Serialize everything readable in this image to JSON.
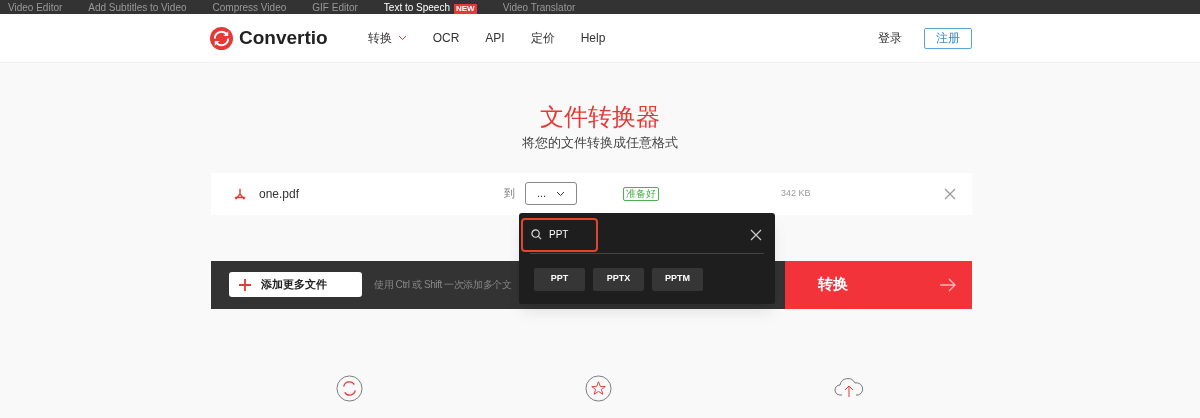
{
  "top_bar": {
    "links": [
      {
        "label": "Video Editor"
      },
      {
        "label": "Add Subtitles to Video"
      },
      {
        "label": "Compress Video"
      },
      {
        "label": "GIF Editor"
      },
      {
        "label": "Text to Speech",
        "badge": "NEW"
      },
      {
        "label": "Video Translator"
      }
    ]
  },
  "header": {
    "logo": "Convertio",
    "nav": [
      {
        "label": "转换",
        "dropdown": true
      },
      {
        "label": "OCR",
        "dropdown": false
      },
      {
        "label": "API",
        "dropdown": false
      },
      {
        "label": "定价",
        "dropdown": false
      },
      {
        "label": "Help",
        "dropdown": false
      }
    ],
    "login": "登录",
    "signup": "注册"
  },
  "hero": {
    "title": "文件转换器",
    "subtitle": "将您的文件转换成任意格式"
  },
  "file": {
    "name": "one.pdf",
    "to_label": "到",
    "format": "...",
    "status": "准备好",
    "size": "342 KB"
  },
  "actions": {
    "add_files": "添加更多文件",
    "hint": "使用 Ctrl 或 Shift 一次添加多个文",
    "convert": "转换"
  },
  "format_menu": {
    "search_value": "PPT",
    "options": [
      "PPT",
      "PPTX",
      "PPTM"
    ]
  }
}
